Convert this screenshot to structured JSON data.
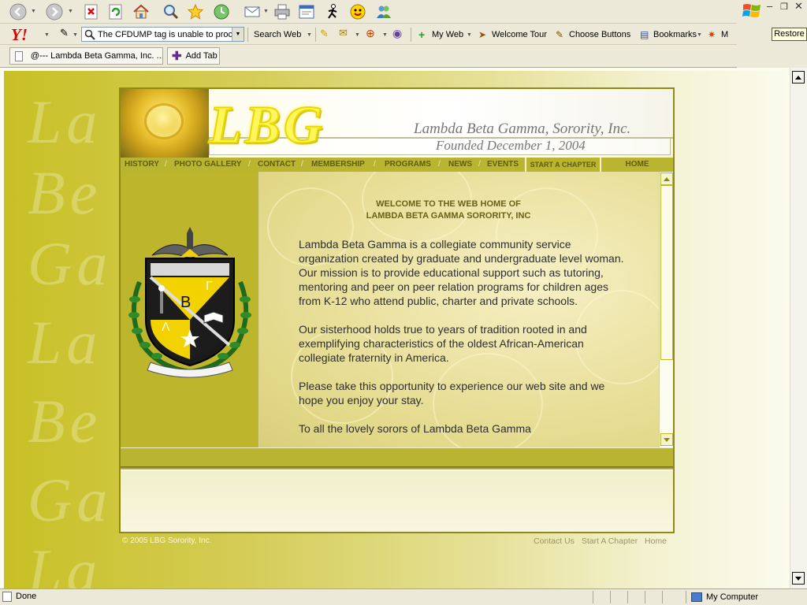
{
  "browser": {
    "search_combo_value": "The CFDUMP tag is unable to proc",
    "toolbar_links": [
      {
        "label": "Search Web"
      },
      {
        "label": "My Web"
      },
      {
        "label": "Welcome Tour"
      },
      {
        "label": "Choose Buttons"
      },
      {
        "label": "Bookmarks"
      },
      {
        "label": "M"
      }
    ],
    "tab_title": "@--- Lambda Beta Gamma, Inc. ...",
    "add_tab_label": "Add Tab",
    "restore_tooltip": "Restore",
    "status_text": "Done",
    "zone_text": "My Computer"
  },
  "site": {
    "logo": "LBG",
    "tagline": "Lambda Beta Gamma, Sorority, Inc.",
    "founded": "Founded December 1, 2004",
    "nav": [
      {
        "label": "HISTORY"
      },
      {
        "label": "PHOTO GALLERY"
      },
      {
        "label": "CONTACT"
      },
      {
        "label": "MEMBERSHIP"
      },
      {
        "label": "PROGRAMS"
      },
      {
        "label": "NEWS"
      },
      {
        "label": "EVENTS"
      }
    ],
    "nav_boxes": [
      {
        "label": "START A CHAPTER"
      },
      {
        "label": "HOME"
      }
    ],
    "crest_letters": {
      "lambda": "Λ",
      "beta": "B",
      "gamma": "Γ"
    },
    "welcome_line1": "WELCOME TO THE WEB HOME OF",
    "welcome_line2": "LAMBDA BETA GAMMA SORORITY, INC",
    "paragraphs": [
      "Lambda Beta Gamma is a collegiate community service organization created by graduate and undergraduate level woman. Our mission is to provide educational support such as tutoring, mentoring and peer on peer relation programs for children ages from K-12 who attend public, charter and private schools.",
      "Our sisterhood holds true to years of tradition rooted in and exemplifying characteristics of the oldest African-American collegiate fraternity in America.",
      "Please take this opportunity to experience our web site and we hope you enjoy your stay.",
      "To all the lovely sorors of Lambda Beta Gamma"
    ],
    "copyright": "© 2005 LBG Sorority, Inc.",
    "footer_links": [
      {
        "label": "Contact Us"
      },
      {
        "label": "Start A Chapter"
      },
      {
        "label": "Home"
      }
    ]
  }
}
